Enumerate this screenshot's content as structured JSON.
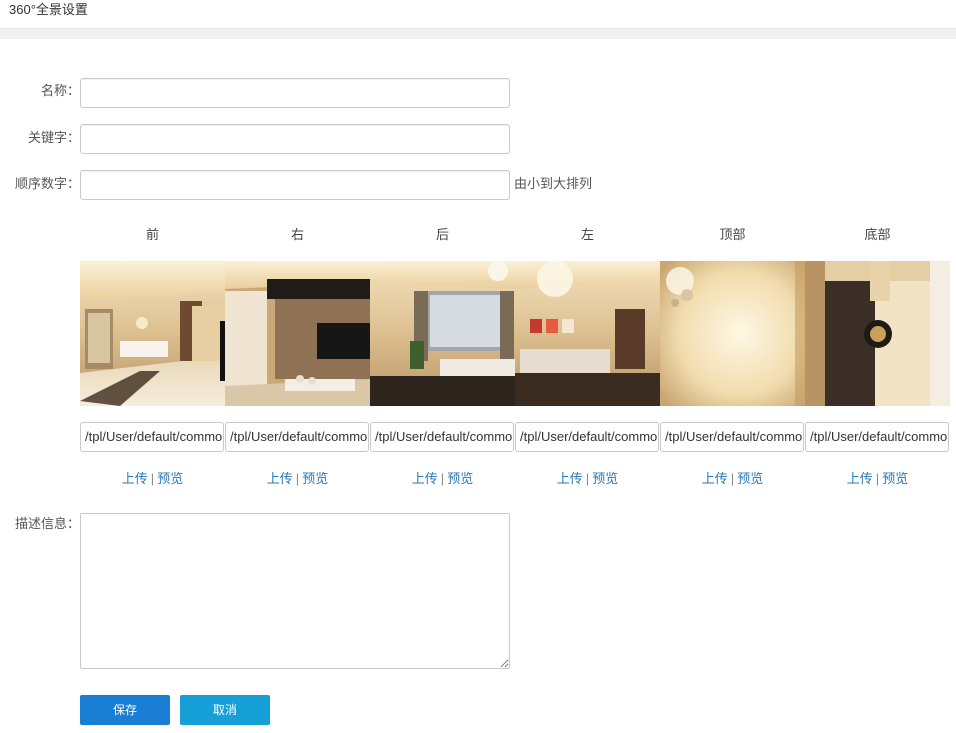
{
  "page": {
    "title": "360°全景设置"
  },
  "form": {
    "name_label": "名称：",
    "keyword_label": "关键字：",
    "order_label": "顺序数字：",
    "order_hint": "由小到大排列",
    "desc_label": "描述信息：",
    "name_value": "",
    "keyword_value": "",
    "order_value": "",
    "desc_value": ""
  },
  "faces": [
    {
      "label": "前",
      "path": "/tpl/User/default/common/",
      "upload": "上传",
      "sep": "|",
      "preview": "预览"
    },
    {
      "label": "右",
      "path": "/tpl/User/default/common/",
      "upload": "上传",
      "sep": "|",
      "preview": "预览"
    },
    {
      "label": "后",
      "path": "/tpl/User/default/common/",
      "upload": "上传",
      "sep": "|",
      "preview": "预览"
    },
    {
      "label": "左",
      "path": "/tpl/User/default/common/",
      "upload": "上传",
      "sep": "|",
      "preview": "预览"
    },
    {
      "label": "顶部",
      "path": "/tpl/User/default/common/",
      "upload": "上传",
      "sep": "|",
      "preview": "预览"
    },
    {
      "label": "底部",
      "path": "/tpl/User/default/common/",
      "upload": "上传",
      "sep": "|",
      "preview": "预览"
    }
  ],
  "buttons": {
    "save": "保存",
    "cancel": "取消"
  },
  "colors": {
    "save_button": "#1a7fd4",
    "cancel_button": "#17a0d8",
    "link": "#2a78b5"
  }
}
